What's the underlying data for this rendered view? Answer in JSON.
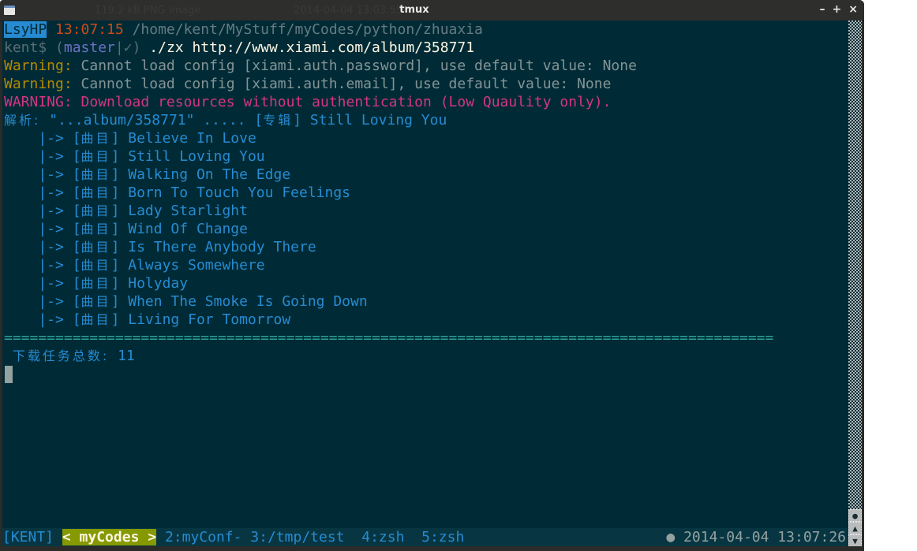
{
  "window": {
    "title": "tmux",
    "ghost_text_left": "119.2 kB PNG image",
    "ghost_text_right": "2014-04-04 13:03:55",
    "controls": {
      "minimize": "–",
      "maximize": "+",
      "close": "×"
    }
  },
  "prompt": {
    "host": "LsyHP",
    "time": "13:07:15",
    "path": "/home/kent/MyStuff/myCodes/python/zhuaxia",
    "user": "kent$",
    "branch_open": "(",
    "branch": "master",
    "branch_status": "|✓",
    "branch_close": ")",
    "command": "./zx http://www.xiami.com/album/358771"
  },
  "output": {
    "warnings": [
      {
        "label": "Warning:",
        "text": " Cannot load config [xiami.auth.password], use default value: None"
      },
      {
        "label": "Warning:",
        "text": " Cannot load config [xiami.auth.email], use default value: None"
      }
    ],
    "error": {
      "label": "WARNING:",
      "text": " Download resources without authentication (Low Quaulity only)."
    },
    "parse_label": "解析:",
    "parse_text": " \"...album/358771\" ..... ",
    "album_tag": "[专辑]",
    "album_title": " Still Loving You",
    "track_prefix": "    |-> ",
    "track_tag": "[曲目]",
    "tracks": [
      "Believe In Love",
      "Still Loving You",
      "Walking On The Edge",
      "Born To Touch You Feelings",
      "Lady Starlight",
      "Wind Of Change",
      "Is There Anybody There",
      "Always Somewhere",
      "Holyday",
      "When The Smoke Is Going Down",
      "Living For Tomorrow"
    ],
    "separator": "==========================================================================================",
    "total_label": "下载任务总数:",
    "total_value": " 11"
  },
  "statusbar": {
    "session": "[KENT]",
    "active_window": "< myCodes >",
    "windows": [
      "2:myConf-",
      "3:/tmp/test",
      "4:zsh",
      "5:zsh"
    ],
    "clock": "● 2014-04-04 13:07:26"
  },
  "scrollbar": {
    "buttons": [
      "scroll-lock",
      "up",
      "down"
    ]
  }
}
